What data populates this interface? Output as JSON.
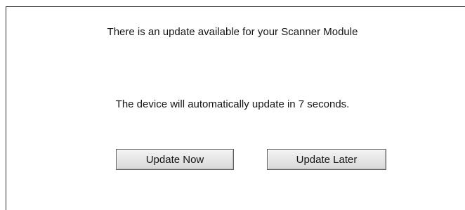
{
  "dialog": {
    "message": "There is an update available for your Scanner Module",
    "countdown_message": "The device will automatically update in 7 seconds.",
    "countdown_seconds": 7
  },
  "buttons": {
    "update_now_label": "Update Now",
    "update_later_label": "Update Later"
  }
}
